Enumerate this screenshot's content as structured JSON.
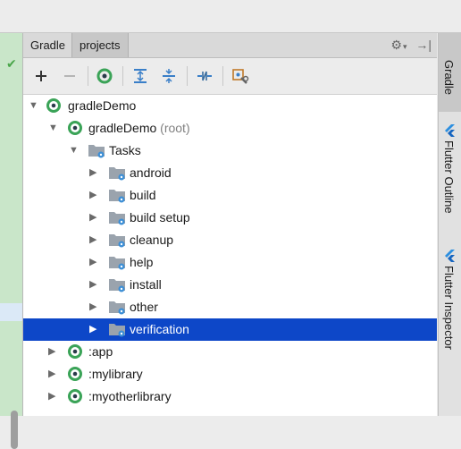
{
  "tool_window": {
    "tabs": [
      {
        "label": "Gradle"
      },
      {
        "label": "projects"
      }
    ],
    "header_icons": [
      "gear-icon",
      "chevron-down-icon",
      "hide-icon"
    ]
  },
  "toolbar": {
    "buttons": [
      {
        "name": "add-button",
        "icon": "plus-icon"
      },
      {
        "name": "remove-button",
        "icon": "minus-icon"
      },
      {
        "name": "refresh-button",
        "icon": "gradle-refresh-icon"
      },
      {
        "name": "expand-all-button",
        "icon": "expand-all-icon"
      },
      {
        "name": "collapse-all-button",
        "icon": "collapse-all-icon"
      },
      {
        "name": "toggle-offline-button",
        "icon": "link-icon"
      },
      {
        "name": "gradle-settings-button",
        "icon": "wrench-icon"
      }
    ]
  },
  "tree": {
    "root": {
      "label": "gradleDemo",
      "expanded": true
    },
    "root_project": {
      "label": "gradleDemo",
      "suffix": "(root)",
      "expanded": true
    },
    "tasks_folder": {
      "label": "Tasks",
      "expanded": true
    },
    "task_groups": [
      {
        "label": "android"
      },
      {
        "label": "build"
      },
      {
        "label": "build setup"
      },
      {
        "label": "cleanup"
      },
      {
        "label": "help"
      },
      {
        "label": "install"
      },
      {
        "label": "other"
      },
      {
        "label": "verification",
        "selected": true
      }
    ],
    "modules": [
      {
        "label": ":app"
      },
      {
        "label": ":mylibrary"
      },
      {
        "label": ":myotherlibrary"
      }
    ]
  },
  "right_sidebar": {
    "tabs": [
      {
        "label": "Gradle",
        "active": true
      },
      {
        "label": "Flutter Outline"
      },
      {
        "label": "Flutter Inspector"
      }
    ]
  },
  "colors": {
    "selection": "#0d47c8",
    "gradle_green": "#3aa357",
    "folder_gray": "#9aa3ad",
    "gear_blue": "#3d8fd6",
    "flutter_blue": "#2d8fe0"
  }
}
